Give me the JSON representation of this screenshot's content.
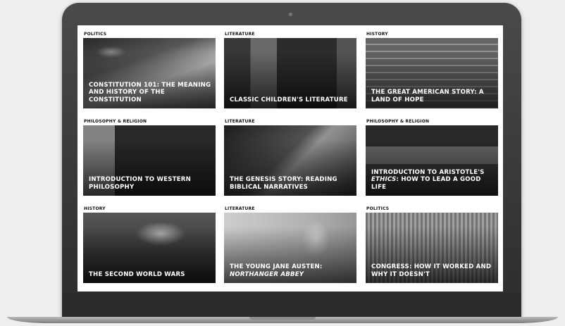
{
  "courses": [
    {
      "category": "POLITICS",
      "title": "CONSTITUTION 101: THE MEANING AND HISTORY OF THE CONSTITUTION",
      "title_em": ""
    },
    {
      "category": "LITERATURE",
      "title": "CLASSIC CHILDREN'S LITERATURE",
      "title_em": ""
    },
    {
      "category": "HISTORY",
      "title": "THE GREAT AMERICAN STORY: A LAND OF HOPE",
      "title_em": ""
    },
    {
      "category": "PHILOSOPHY & RELIGION",
      "title": "INTRODUCTION TO WESTERN PHILOSOPHY",
      "title_em": ""
    },
    {
      "category": "LITERATURE",
      "title": "THE GENESIS STORY: READING BIBLICAL NARRATIVES",
      "title_em": ""
    },
    {
      "category": "PHILOSOPHY & RELIGION",
      "title_before": "INTRODUCTION TO ARISTOTLE'S",
      "title_em": "ETHICS",
      "title_after": ": HOW TO LEAD A GOOD LIFE"
    },
    {
      "category": "HISTORY",
      "title": "THE SECOND WORLD WARS",
      "title_em": ""
    },
    {
      "category": "LITERATURE",
      "title_before": "THE YOUNG JANE AUSTEN:",
      "title_em": "NORTHANGER ABBEY",
      "title_after": ""
    },
    {
      "category": "POLITICS",
      "title": "CONGRESS: HOW IT WORKED AND WHY IT DOESN'T",
      "title_em": ""
    }
  ]
}
